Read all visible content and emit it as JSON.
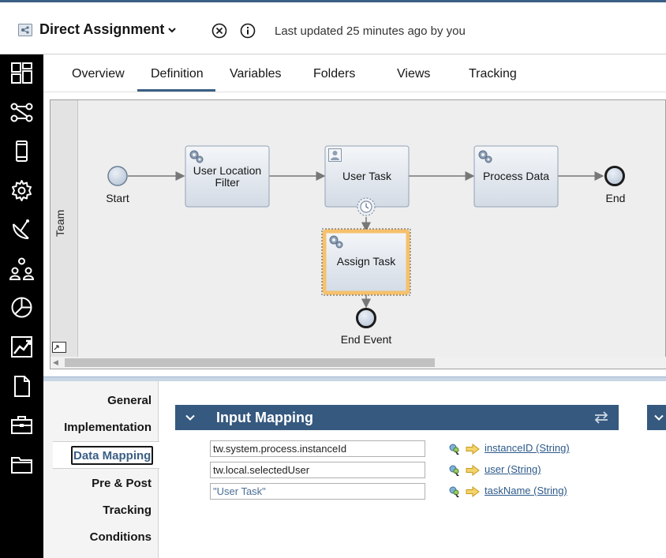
{
  "header": {
    "app_title": "Direct Assignment",
    "last_updated": "Last updated 25 minutes ago by you"
  },
  "tabs": [
    "Overview",
    "Definition",
    "Variables",
    "Folders",
    "Views",
    "Tracking"
  ],
  "active_tab": "Definition",
  "lane": {
    "label": "Team"
  },
  "diagram": {
    "nodes": {
      "start": "Start",
      "user_location_filter": "User Location Filter",
      "user_task": "User Task",
      "process_data": "Process Data",
      "end": "End",
      "assign_task": "Assign Task",
      "end_event": "End Event"
    }
  },
  "side_menu": {
    "general": "General",
    "implementation": "Implementation",
    "data_mapping": "Data Mapping",
    "pre_post": "Pre & Post",
    "tracking": "Tracking",
    "conditions": "Conditions"
  },
  "input_mapping": {
    "title": "Input Mapping",
    "rows": [
      {
        "value": "tw.system.process.instanceId",
        "target": "instanceID (String)"
      },
      {
        "value": "tw.local.selectedUser",
        "target": "user (String)"
      },
      {
        "value": "\"User Task\"",
        "target": "taskName (String)"
      }
    ]
  },
  "colors": {
    "accent": "#3b5f85",
    "panel_header": "#36597f",
    "nav_background": "#000000",
    "selected_task_border": "#f5c16c"
  }
}
